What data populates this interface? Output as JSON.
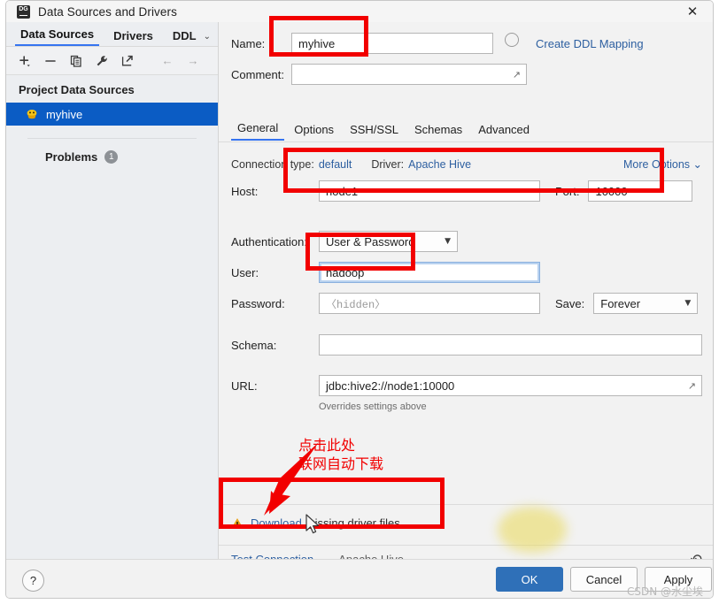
{
  "window": {
    "title": "Data Sources and Drivers",
    "app_icon": "datagrip-icon",
    "close_label": "✕"
  },
  "sidebar": {
    "tabs": [
      {
        "label": "Data Sources",
        "active": true
      },
      {
        "label": "Drivers",
        "active": false
      },
      {
        "label": "DDL",
        "active": false
      }
    ],
    "tabs_overflow_caret": "⌄",
    "toolbar": [
      {
        "name": "add-icon",
        "glyph": "+"
      },
      {
        "name": "remove-icon",
        "glyph": "−"
      },
      {
        "name": "duplicate-icon",
        "glyph": "❐"
      },
      {
        "name": "wrench-icon",
        "glyph": "🔧"
      },
      {
        "name": "open-external-icon",
        "glyph": "↗"
      }
    ],
    "nav": [
      {
        "name": "back-icon",
        "glyph": "←"
      },
      {
        "name": "forward-icon",
        "glyph": "→"
      }
    ],
    "group_header": "Project Data Sources",
    "data_source": {
      "label": "myhive",
      "selected": true
    },
    "problems": {
      "label": "Problems",
      "count": "1"
    }
  },
  "form": {
    "name": {
      "label": "Name:",
      "value": "myhive"
    },
    "create_ddl_mapping": "Create DDL Mapping",
    "comment": {
      "label": "Comment:",
      "value": ""
    },
    "tabs": [
      {
        "label": "General",
        "active": true
      },
      {
        "label": "Options",
        "active": false
      },
      {
        "label": "SSH/SSL",
        "active": false
      },
      {
        "label": "Schemas",
        "active": false
      },
      {
        "label": "Advanced",
        "active": false
      }
    ],
    "meta": {
      "connection_type_key": "Connection type:",
      "connection_type_value": "default",
      "driver_key": "Driver:",
      "driver_value": "Apache Hive",
      "more_options": "More Options ⌄"
    },
    "host": {
      "label": "Host:",
      "value": "node1"
    },
    "port": {
      "label": "Port:",
      "value": "10000"
    },
    "authentication": {
      "label": "Authentication:",
      "value": "User & Password"
    },
    "user": {
      "label": "User:",
      "value": "hadoop"
    },
    "password": {
      "label": "Password:",
      "value": "",
      "placeholder": "〈hidden〉"
    },
    "save": {
      "label": "Save:",
      "value": "Forever"
    },
    "schema": {
      "label": "Schema:",
      "value": ""
    },
    "url": {
      "label": "URL:",
      "value": "jdbc:hive2://node1:10000",
      "note": "Overrides settings above"
    },
    "driver_warning": {
      "link_text": "Download",
      "rest_text": "missing driver files",
      "icon": "warning-triangle-icon"
    },
    "status": {
      "test_connection": "Test Connection",
      "driver_name": "Apache Hive",
      "revert_glyph": "↶"
    }
  },
  "footer": {
    "help": "?",
    "ok": "OK",
    "cancel": "Cancel",
    "apply": "Apply"
  },
  "annotations": {
    "chinese_note_line1": "点击此处",
    "chinese_note_line2": "联网自动下载",
    "highlight_color": "#f20000",
    "watermark": "CSDN @水尘埃"
  }
}
